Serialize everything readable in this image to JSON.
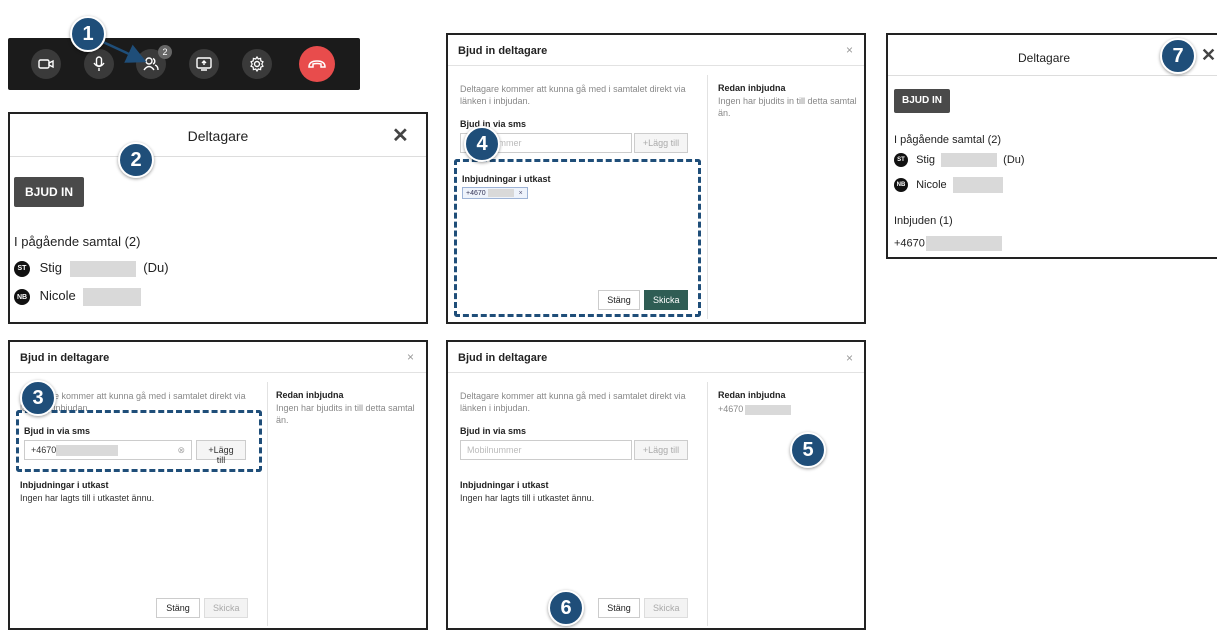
{
  "toolbar": {
    "participants_count": "2",
    "colors": {
      "bar": "#1b1b1b",
      "button": "#3a3a3a",
      "hangup": "#e84c4c"
    },
    "icons": [
      "camera-icon",
      "microphone-icon",
      "participants-icon",
      "share-screen-icon",
      "settings-icon",
      "hang-up-icon"
    ]
  },
  "badges": [
    "1",
    "2",
    "3",
    "4",
    "5",
    "6",
    "7"
  ],
  "badge_color": "#1f4e79",
  "participants_large": {
    "title": "Deltagare",
    "close": "✕",
    "invite_button": "BJUD IN",
    "in_call_heading": "I pågående samtal (2)",
    "members": [
      {
        "initials": "ST",
        "name": "Stig",
        "suffix": "(Du)"
      },
      {
        "initials": "NB",
        "name": "Nicole",
        "suffix": ""
      }
    ]
  },
  "invite_dialog_3": {
    "title": "Bjud in deltagare",
    "close": "×",
    "intro": "Deltagare kommer att kunna gå med i samtalet direkt via länken i inbjudan.",
    "sms_label": "Bjud in via sms",
    "phone_value": "+4670",
    "add_button": "+Lägg till",
    "drafts_label": "Inbjudningar i utkast",
    "drafts_empty": "Ingen har lagts till i utkastet ännu.",
    "already_label": "Redan inbjudna",
    "already_empty": "Ingen har bjudits in till detta samtal än.",
    "close_button": "Stäng",
    "send_button": "Skicka"
  },
  "invite_dialog_4": {
    "title": "Bjud in deltagare",
    "close": "×",
    "intro": "Deltagare kommer att kunna gå med i samtalet direkt via länken i inbjudan.",
    "sms_label": "Bjud in via sms",
    "phone_placeholder": "Mobilnummer",
    "add_button": "+Lägg till",
    "drafts_label": "Inbjudningar i utkast",
    "draft_chip": "+4670",
    "draft_chip_remove": "×",
    "already_label": "Redan inbjudna",
    "already_empty": "Ingen har bjudits in till detta samtal än.",
    "close_button": "Stäng",
    "send_button": "Skicka"
  },
  "invite_dialog_5": {
    "title": "Bjud in deltagare",
    "close": "×",
    "intro": "Deltagare kommer att kunna gå med i samtalet direkt via länken i inbjudan.",
    "sms_label": "Bjud in via sms",
    "phone_placeholder": "Mobilnummer",
    "add_button": "+Lägg till",
    "drafts_label": "Inbjudningar i utkast",
    "drafts_empty": "Ingen har lagts till i utkastet ännu.",
    "already_label": "Redan inbjudna",
    "already_value": "+4670",
    "close_button": "Stäng",
    "send_button": "Skicka"
  },
  "participants_small": {
    "title": "Deltagare",
    "close": "✕",
    "invite_button": "BJUD IN",
    "in_call_heading": "I pågående samtal (2)",
    "members": [
      {
        "initials": "ST",
        "name": "Stig",
        "suffix": "(Du)"
      },
      {
        "initials": "NB",
        "name": "Nicole",
        "suffix": ""
      }
    ],
    "invited_heading": "Inbjuden (1)",
    "invited_value": "+4670"
  }
}
